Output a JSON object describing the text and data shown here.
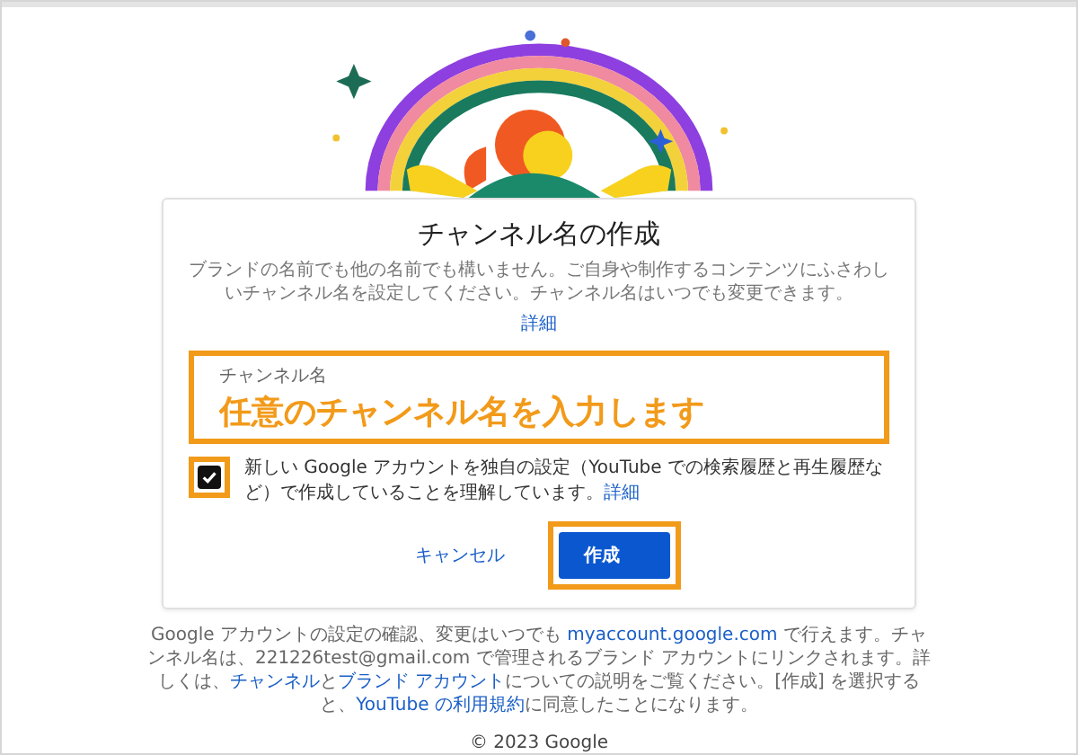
{
  "dialog": {
    "title": "チャンネル名の作成",
    "description": "ブランドの名前でも他の名前でも構いません。ご自身や制作するコンテンツにふさわしいチャンネル名を設定してください。チャンネル名はいつでも変更できます。",
    "details_link": "詳細",
    "field": {
      "label": "チャンネル名",
      "value": "任意のチャンネル名を入力します",
      "highlighted": true
    },
    "agreement": {
      "checked": true,
      "highlighted": true,
      "text": "新しい Google アカウントを独自の設定（YouTube での検索履歴と再生履歴など）で作成していることを理解しています。",
      "link": "詳細"
    },
    "buttons": [
      {
        "label": "キャンセル",
        "kind": "text",
        "highlighted": false
      },
      {
        "label": "作成",
        "kind": "primary",
        "highlighted": true
      }
    ]
  },
  "footer": {
    "segments": [
      {
        "kind": "text",
        "text": "Google アカウントの設定の確認、変更はいつでも "
      },
      {
        "kind": "link",
        "text": "myaccount.google.com"
      },
      {
        "kind": "text",
        "text": " で行えます。チャンネル名は、221226test@gmail.com で管理されるブランド アカウントにリンクされます。詳しくは、"
      },
      {
        "kind": "link",
        "text": "チャンネル"
      },
      {
        "kind": "text",
        "text": "と"
      },
      {
        "kind": "link",
        "text": "ブランド アカウント"
      },
      {
        "kind": "text",
        "text": "についての説明をご覧ください。[作成] を選択すると、"
      },
      {
        "kind": "link",
        "text": "YouTube の利用規約"
      },
      {
        "kind": "text",
        "text": "に同意したことになります。"
      }
    ]
  },
  "copyright": "© 2023 Google"
}
